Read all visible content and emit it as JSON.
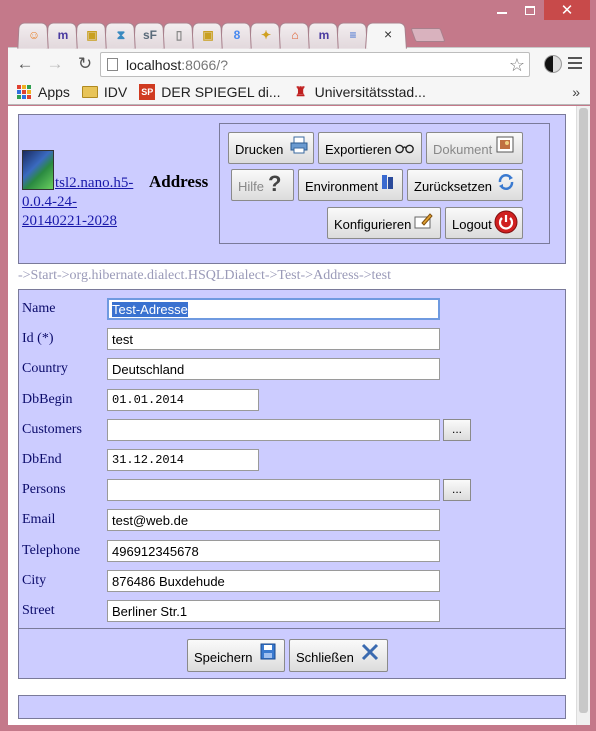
{
  "browser": {
    "tab_icons": [
      {
        "icon": "firefox-orange-icon",
        "color": "#e8802a",
        "glyph": "☺"
      },
      {
        "icon": "m-logo-icon",
        "color": "#4a3aa0",
        "glyph": "m"
      },
      {
        "icon": "briefcase-icon",
        "color": "#c9a020",
        "glyph": "▣"
      },
      {
        "icon": "hourglass-icon",
        "color": "#3a8ac0",
        "glyph": "⧗"
      },
      {
        "icon": "sf-icon",
        "color": "#5a6a7a",
        "glyph": "sF"
      },
      {
        "icon": "document-icon",
        "color": "#888888",
        "glyph": "▯"
      },
      {
        "icon": "briefcase-icon",
        "color": "#c9a020",
        "glyph": "▣"
      },
      {
        "icon": "google-icon",
        "color": "#4a8af0",
        "glyph": "8"
      },
      {
        "icon": "puzzle-icon",
        "color": "#d0a020",
        "glyph": "✦"
      },
      {
        "icon": "home-icon",
        "color": "#e06030",
        "glyph": "⌂"
      },
      {
        "icon": "m-logo-icon",
        "color": "#4a3aa0",
        "glyph": "m"
      },
      {
        "icon": "docs-icon",
        "color": "#3a6ad0",
        "glyph": "≡"
      },
      {
        "icon": "active-tab-icon",
        "color": "#888888",
        "glyph": ""
      }
    ],
    "active_tab_close": "×",
    "url_host": "localhost",
    "url_rest": ":8066/?",
    "bookmarks": [
      {
        "label": "Apps",
        "icon": "apps-grid-icon"
      },
      {
        "label": "IDV",
        "icon": "folder-icon"
      },
      {
        "label": "DER SPIEGEL di...",
        "icon": "spiegel-icon",
        "badge": "SP",
        "color": "#d03a20"
      },
      {
        "label": "Universitätsstad...",
        "icon": "crest-icon",
        "color": "#c02020"
      }
    ],
    "bookmarks_more": "»"
  },
  "header": {
    "logo_link": "tsl2.nano.h5-0.0.4-24-20140221-2028",
    "title": "Address",
    "buttons": {
      "print": "Drucken",
      "export": "Exportieren",
      "document": "Dokument",
      "help": "Hilfe",
      "environment": "Environment",
      "reset": "Zurücksetzen",
      "configure": "Konfigurieren",
      "logout": "Logout"
    }
  },
  "breadcrumb": "->Start->org.hibernate.dialect.HSQLDialect->Test->Address->test",
  "form": {
    "fields": [
      {
        "label": "Name",
        "value": "Test-Adresse"
      },
      {
        "label": "Id (*)",
        "value": "test"
      },
      {
        "label": "Country",
        "value": "Deutschland"
      },
      {
        "label": "DbBegin",
        "value": "01.01.2014"
      },
      {
        "label": "Customers",
        "value": "",
        "button": "..."
      },
      {
        "label": "DbEnd",
        "value": "31.12.2014"
      },
      {
        "label": "Persons",
        "value": "",
        "button": "..."
      },
      {
        "label": "Email",
        "value": "test@web.de"
      },
      {
        "label": "Telephone",
        "value": "496912345678"
      },
      {
        "label": "City",
        "value": "876486 Buxdehude"
      },
      {
        "label": "Street",
        "value": "Berliner Str.1"
      }
    ]
  },
  "footer": {
    "save": "Speichern",
    "close": "Schließen"
  }
}
